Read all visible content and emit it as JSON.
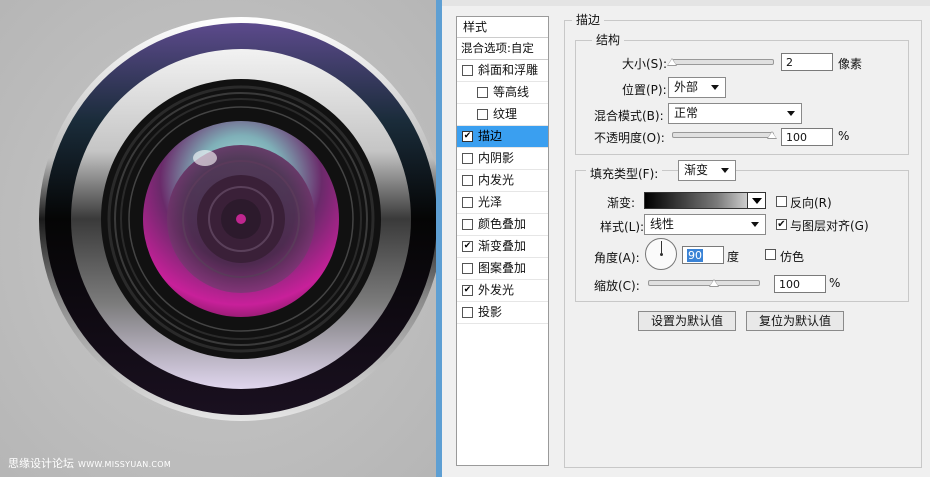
{
  "watermark": {
    "text": "思缘设计论坛",
    "url": "WWW.MISSYUAN.COM"
  },
  "style_list": {
    "header": "样式",
    "blend_options": "混合选项:自定",
    "items": [
      {
        "label": "斜面和浮雕",
        "checked": false,
        "sub": false,
        "selected": false
      },
      {
        "label": "等高线",
        "checked": false,
        "sub": true,
        "selected": false
      },
      {
        "label": "纹理",
        "checked": false,
        "sub": true,
        "selected": false
      },
      {
        "label": "描边",
        "checked": true,
        "sub": false,
        "selected": true
      },
      {
        "label": "内阴影",
        "checked": false,
        "sub": false,
        "selected": false
      },
      {
        "label": "内发光",
        "checked": false,
        "sub": false,
        "selected": false
      },
      {
        "label": "光泽",
        "checked": false,
        "sub": false,
        "selected": false
      },
      {
        "label": "颜色叠加",
        "checked": false,
        "sub": false,
        "selected": false
      },
      {
        "label": "渐变叠加",
        "checked": true,
        "sub": false,
        "selected": false
      },
      {
        "label": "图案叠加",
        "checked": false,
        "sub": false,
        "selected": false
      },
      {
        "label": "外发光",
        "checked": true,
        "sub": false,
        "selected": false
      },
      {
        "label": "投影",
        "checked": false,
        "sub": false,
        "selected": false
      }
    ]
  },
  "stroke": {
    "title": "描边",
    "structure": {
      "title": "结构",
      "size_label": "大小(S):",
      "size_value": "2",
      "size_unit": "像素",
      "size_fraction": 0.0,
      "position_label": "位置(P):",
      "position_value": "外部",
      "blend_label": "混合模式(B):",
      "blend_value": "正常",
      "opacity_label": "不透明度(O):",
      "opacity_value": "100",
      "opacity_unit": "%",
      "opacity_fraction": 1.0
    },
    "fill": {
      "type_label": "填充类型(F):",
      "type_value": "渐变",
      "gradient_label": "渐变:",
      "reverse_label": "反向(R)",
      "reverse_checked": false,
      "style_label": "样式(L):",
      "style_value": "线性",
      "align_label": "与图层对齐(G)",
      "align_checked": true,
      "angle_label": "角度(A):",
      "angle_value": "90",
      "angle_unit": "度",
      "dither_label": "仿色",
      "dither_checked": false,
      "scale_label": "缩放(C):",
      "scale_value": "100",
      "scale_unit": "%",
      "scale_fraction": 0.6
    },
    "buttons": {
      "set_default": "设置为默认值",
      "reset_default": "复位为默认值"
    }
  },
  "colors": {
    "selection": "#3a9ff0",
    "divider": "#5e9fd3",
    "lens_magenta": "#c0268f",
    "lens_cyan": "#a8e4dc"
  }
}
